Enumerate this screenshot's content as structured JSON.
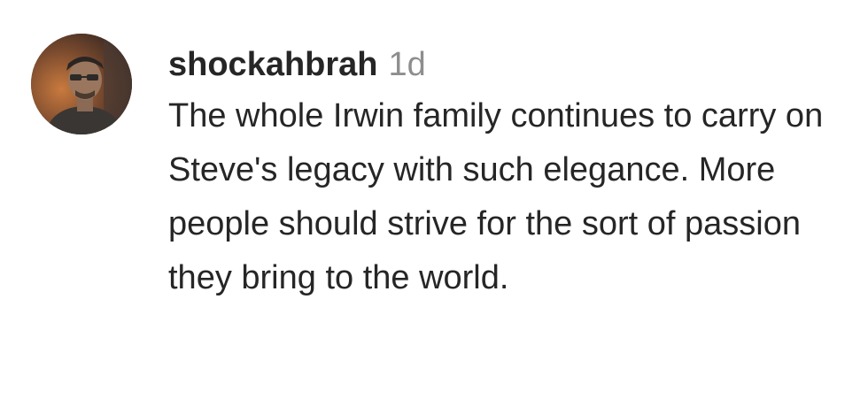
{
  "comment": {
    "username": "shockahbrah",
    "timestamp": "1d",
    "text": "The whole Irwin family continues to carry on Steve's legacy with such elegance. More people should strive for the sort of passion they bring to the world."
  },
  "colors": {
    "text": "#262626",
    "timestamp": "#8e8e8e",
    "background": "#ffffff"
  },
  "icons": {
    "avatar": "profile-photo"
  }
}
